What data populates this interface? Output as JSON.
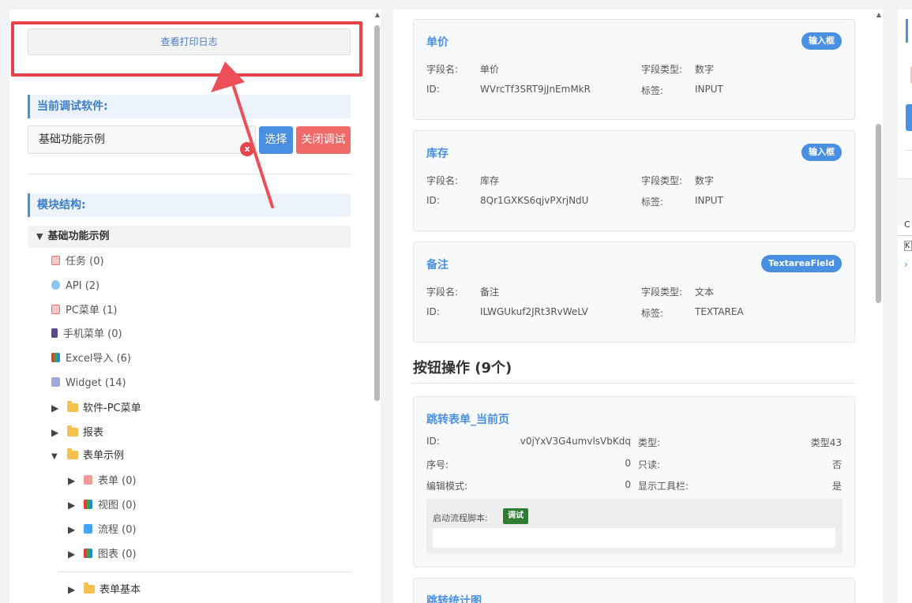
{
  "left": {
    "log_button": "查看打印日志",
    "current_software_heading": "当前调试软件:",
    "software_value": "基础功能示例",
    "clear_glyph": "x",
    "select_button": "选择",
    "close_debug_button": "关闭调试",
    "module_heading": "模块结构:",
    "tree_root": "基础功能示例",
    "tree_items": [
      "任务 (0)",
      "API (2)",
      "PC菜单 (1)",
      "手机菜单 (0)",
      "Excel导入 (6)",
      "Widget (14)"
    ],
    "folders": [
      "软件-PC菜单",
      "报表",
      "表单示例"
    ],
    "sub_items": [
      "表单 (0)",
      "视图 (0)",
      "流程 (0)",
      "图表 (0)"
    ],
    "bottom_folder": "表单基本"
  },
  "labels": {
    "field_name": "字段名:",
    "id": "ID:",
    "field_type": "字段类型:",
    "tag": "标签:"
  },
  "fields": [
    {
      "title": "单价",
      "badge": "输入框",
      "name": "单价",
      "id": "WVrcTf3SRT9jJnEmMkR",
      "type": "数字",
      "tag": "INPUT"
    },
    {
      "title": "库存",
      "badge": "输入框",
      "name": "库存",
      "id": "8Qr1GXKS6qjvPXrjNdU",
      "type": "数字",
      "tag": "INPUT"
    },
    {
      "title": "备注",
      "badge": "TextareaField",
      "name": "备注",
      "id": "ILWGUkuf2JRt3RvWeLV",
      "type": "文本",
      "tag": "TEXTAREA"
    }
  ],
  "buttons_section_title": "按钮操作 (9个)",
  "action": {
    "title": "跳转表单_当前页",
    "id_label": "ID:",
    "id_value": "v0jYxV3G4umvlsVbKdq",
    "type_label": "类型:",
    "type_value": "类型43",
    "seq_label": "序号:",
    "seq_value": "0",
    "readonly_label": "只读:",
    "readonly_value": "否",
    "edit_mode_label": "编辑模式:",
    "edit_mode_value": "0",
    "toolbar_label": "显示工具栏:",
    "toolbar_value": "是",
    "script_label": "启动流程脚本:",
    "debug_tag": "调试"
  },
  "action2": {
    "title": "跳转统计图"
  },
  "right": {
    "c_letter": "C",
    "k_letter": "K",
    "chevron": "›"
  },
  "colors": {
    "accent": "#4a90e2",
    "danger": "#f06a6a",
    "highlight": "#e8424b",
    "success": "#2e7d32"
  }
}
